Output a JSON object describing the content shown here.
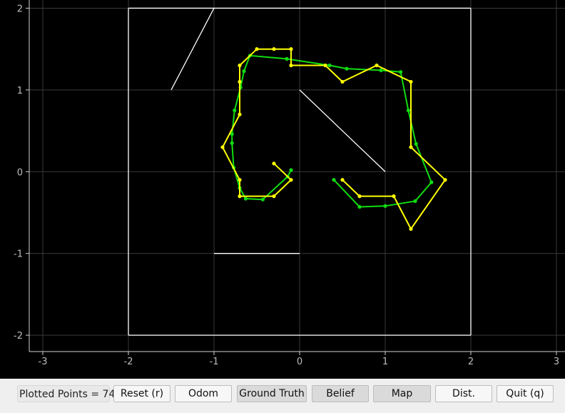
{
  "status": {
    "label": "Plotted Points",
    "value": 74
  },
  "buttons": [
    {
      "id": "reset",
      "label": "Reset (r)",
      "checked": false
    },
    {
      "id": "odom",
      "label": "Odom",
      "checked": false
    },
    {
      "id": "ground-truth",
      "label": "Ground Truth",
      "checked": true
    },
    {
      "id": "belief",
      "label": "Belief",
      "checked": true
    },
    {
      "id": "map",
      "label": "Map",
      "checked": true
    },
    {
      "id": "dist",
      "label": "Dist.",
      "checked": false
    },
    {
      "id": "quit",
      "label": "Quit (q)",
      "checked": false
    }
  ],
  "chart_data": {
    "type": "line",
    "title": "",
    "xlabel": "",
    "ylabel": "",
    "xlim": [
      -3.5,
      3.1
    ],
    "ylim": [
      -2.2,
      2.1
    ],
    "grid": true,
    "x_ticks": [
      -3,
      -2,
      -1,
      0,
      1,
      2,
      3
    ],
    "y_ticks": [
      -2,
      -1,
      0,
      1,
      2
    ],
    "colors": {
      "background": "#000000",
      "grid": "#3a3a3a",
      "axis": "#cfcfcf",
      "map": "#ffffff",
      "ground_truth": "#10dd10",
      "belief": "#ffff00"
    },
    "map_segments": [
      [
        [
          -2,
          -2
        ],
        [
          2,
          -2
        ]
      ],
      [
        [
          2,
          -2
        ],
        [
          2,
          2
        ]
      ],
      [
        [
          2,
          2
        ],
        [
          -2,
          2
        ]
      ],
      [
        [
          -2,
          2
        ],
        [
          -2,
          -2
        ]
      ],
      [
        [
          -1,
          2
        ],
        [
          -1.5,
          1
        ]
      ],
      [
        [
          0,
          1
        ],
        [
          1,
          0
        ]
      ],
      [
        [
          -1,
          -1
        ],
        [
          0,
          -1
        ]
      ]
    ],
    "series": [
      {
        "key": "ground_truth",
        "points": [
          [
            -0.1,
            0.02
          ],
          [
            -0.14,
            -0.06
          ],
          [
            -0.43,
            -0.34
          ],
          [
            -0.63,
            -0.33
          ],
          [
            -0.7,
            -0.2
          ],
          [
            -0.77,
            0.05
          ],
          [
            -0.79,
            0.35
          ],
          [
            -0.79,
            0.46
          ],
          [
            -0.76,
            0.75
          ],
          [
            -0.69,
            1.03
          ],
          [
            -0.65,
            1.23
          ],
          [
            -0.58,
            1.42
          ],
          [
            -0.15,
            1.38
          ],
          [
            0.35,
            1.3
          ],
          [
            0.55,
            1.26
          ],
          [
            0.95,
            1.24
          ],
          [
            1.18,
            1.22
          ],
          [
            1.27,
            0.75
          ],
          [
            1.36,
            0.34
          ],
          [
            1.54,
            -0.13
          ],
          [
            1.35,
            -0.36
          ],
          [
            1.0,
            -0.42
          ],
          [
            0.7,
            -0.43
          ],
          [
            0.4,
            -0.1
          ]
        ]
      },
      {
        "key": "belief",
        "points": [
          [
            -0.3,
            0.1
          ],
          [
            -0.1,
            -0.1
          ],
          [
            -0.3,
            -0.3
          ],
          [
            -0.7,
            -0.3
          ],
          [
            -0.7,
            -0.1
          ],
          [
            -0.9,
            0.3
          ],
          [
            -0.7,
            0.7
          ],
          [
            -0.7,
            1.1
          ],
          [
            -0.7,
            1.3
          ],
          [
            -0.5,
            1.5
          ],
          [
            -0.3,
            1.5
          ],
          [
            -0.1,
            1.5
          ],
          [
            -0.1,
            1.3
          ],
          [
            0.3,
            1.3
          ],
          [
            0.5,
            1.1
          ],
          [
            0.9,
            1.3
          ],
          [
            1.3,
            1.1
          ],
          [
            1.3,
            0.3
          ],
          [
            1.7,
            -0.1
          ],
          [
            1.3,
            -0.7
          ],
          [
            1.1,
            -0.3
          ],
          [
            0.7,
            -0.3
          ],
          [
            0.5,
            -0.1
          ]
        ]
      }
    ]
  }
}
